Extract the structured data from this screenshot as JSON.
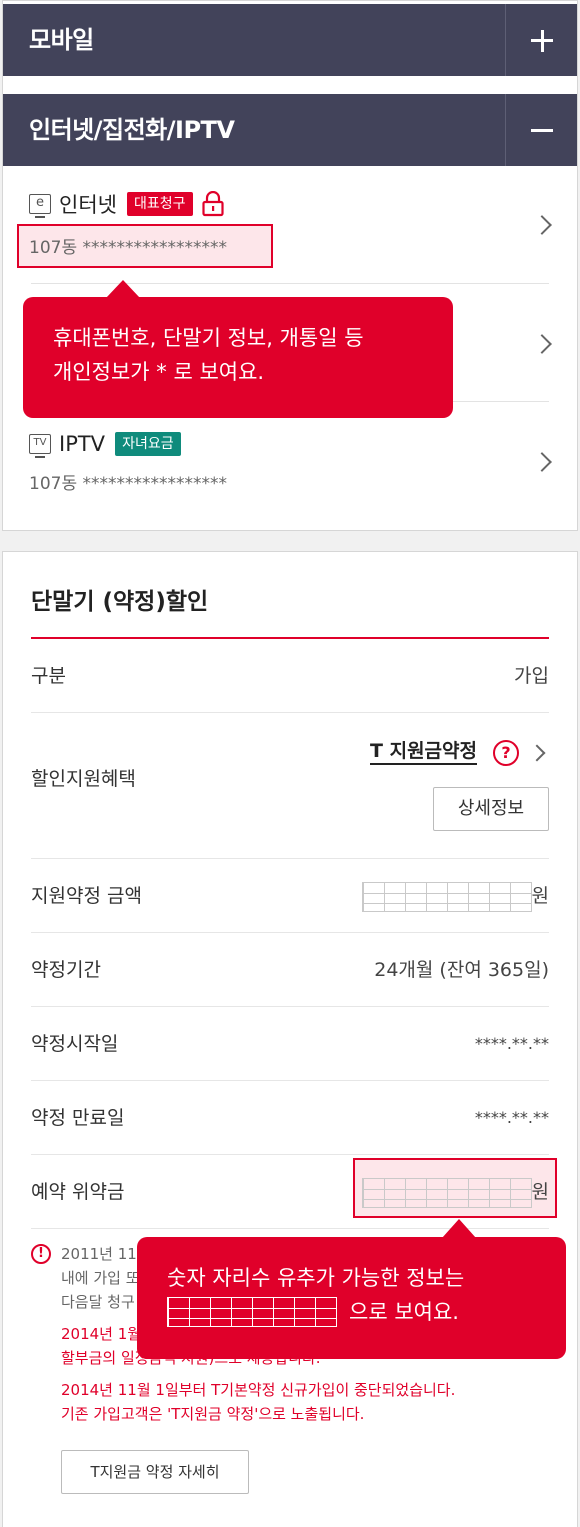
{
  "accordion": {
    "mobile_title": "모바일",
    "internet_title": "인터넷/집전화/IPTV"
  },
  "services": [
    {
      "icon_char": "e",
      "name": "인터넷",
      "badge": "대표청구",
      "badge_color": "#e0002a",
      "number": "107동 *****************"
    },
    {
      "icon_char": "TV",
      "name": "IPTV",
      "badge": "자녀요금",
      "badge_color": "#0f8b7c",
      "number": "107동 *****************"
    }
  ],
  "tooltip1": {
    "line1": "휴대폰번호, 단말기 정보, 개통일 등",
    "line2": "개인정보가 * 로 보여요."
  },
  "discount": {
    "title": "단말기 (약정)할인",
    "rows": [
      {
        "label": "구분",
        "value": "가입"
      },
      {
        "label": "할인지원혜택",
        "link": "T 지원금약정",
        "help": "?",
        "detail_button": "상세정보"
      },
      {
        "label": "지원약정 금액",
        "unit": "원"
      },
      {
        "label": "약정기간",
        "value": "24개월 (잔여 365일)"
      },
      {
        "label": "약정시작일",
        "value": "****.**.**"
      },
      {
        "label": "약정 만료일",
        "value": "****.**.**"
      },
      {
        "label": "예약 위약금",
        "unit": "원"
      }
    ]
  },
  "notes": {
    "note1_a": "2011년 11",
    "note1_b": "내에 가입 또",
    "note1_c": "다음달 청구",
    "note2_a": "2014년 1월",
    "note2_b": "할부금의 일정금액 지원)으로 제공합니다.",
    "note3_a": "2014년 11월 1일부터 T기본약정 신규가입이 중단되었습니다.",
    "note3_b": "기존 가입고객은 'T지원금 약정'으로 노출됩니다.",
    "button": "T지원금 약정 자세히"
  },
  "tooltip2": {
    "line1": "숫자 자리수 유추가 가능한 정보는",
    "line2_suffix": "으로 보여요."
  },
  "colors": {
    "accent": "#e0002a",
    "header": "#42435a",
    "teal": "#0f8b7c"
  }
}
